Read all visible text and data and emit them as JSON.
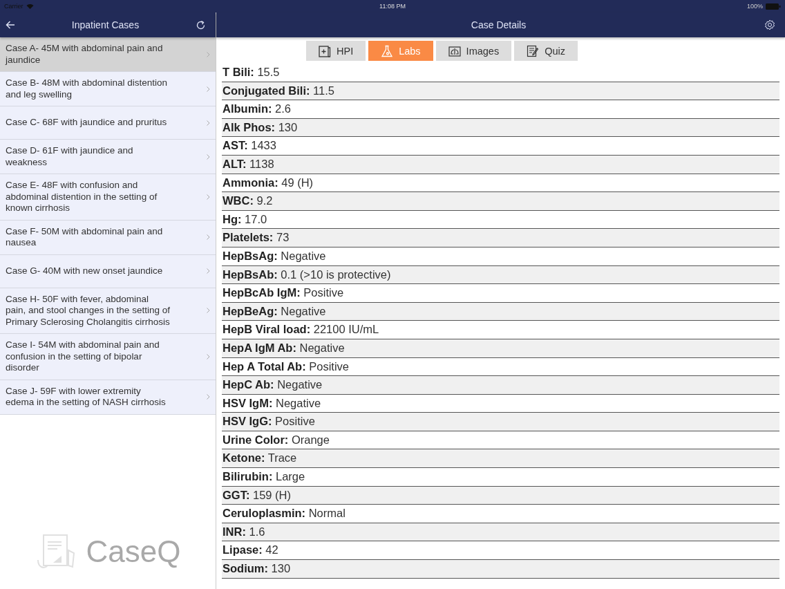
{
  "status_bar": {
    "carrier": "Carrier",
    "time": "11:08 PM",
    "battery": "100%"
  },
  "sidebar": {
    "title": "Inpatient Cases",
    "logo_text": "CaseQ",
    "items": [
      {
        "label": "Case A- 45M with abdominal pain and jaundice",
        "selected": true
      },
      {
        "label": "Case B- 48M with abdominal distention and leg swelling",
        "selected": false
      },
      {
        "label": "Case C- 68F with jaundice and pruritus",
        "selected": false
      },
      {
        "label": "Case D- 61F with jaundice and weakness",
        "selected": false
      },
      {
        "label": "Case E- 48F with confusion and abdominal distention in the setting of known cirrhosis",
        "selected": false
      },
      {
        "label": "Case F- 50M with abdominal pain and nausea",
        "selected": false
      },
      {
        "label": "Case G- 40M with new onset jaundice",
        "selected": false
      },
      {
        "label": "Case H- 50F with fever, abdominal pain, and stool changes in the setting of Primary Sclerosing Cholangitis cirrhosis",
        "selected": false
      },
      {
        "label": "Case I- 54M with abdominal pain and confusion in the setting of bipolar disorder",
        "selected": false
      },
      {
        "label": "Case J- 59F with lower extremity edema in the setting of NASH cirrhosis",
        "selected": false
      }
    ]
  },
  "detail": {
    "title": "Case Details",
    "tabs": [
      {
        "label": "HPI",
        "kind": "hpi",
        "selected": false
      },
      {
        "label": "Labs",
        "kind": "labs",
        "selected": true
      },
      {
        "label": "Images",
        "kind": "images",
        "selected": false
      },
      {
        "label": "Quiz",
        "kind": "quiz",
        "selected": false
      }
    ],
    "labs": [
      {
        "name": "T Bili:",
        "value": "15.5"
      },
      {
        "name": "Conjugated Bili:",
        "value": "11.5"
      },
      {
        "name": "Albumin:",
        "value": "2.6"
      },
      {
        "name": "Alk Phos:",
        "value": "130"
      },
      {
        "name": "AST:",
        "value": "1433"
      },
      {
        "name": "ALT:",
        "value": "1138"
      },
      {
        "name": "Ammonia:",
        "value": "49 (H)"
      },
      {
        "name": "WBC:",
        "value": "9.2"
      },
      {
        "name": "Hg:",
        "value": "17.0"
      },
      {
        "name": "Platelets:",
        "value": "73"
      },
      {
        "name": "HepBsAg:",
        "value": "Negative"
      },
      {
        "name": "HepBsAb:",
        "value": "0.1 (>10 is protective)"
      },
      {
        "name": "HepBcAb IgM:",
        "value": "Positive"
      },
      {
        "name": "HepBeAg:",
        "value": "Negative"
      },
      {
        "name": "HepB Viral load:",
        "value": "22100 IU/mL"
      },
      {
        "name": "HepA IgM Ab:",
        "value": "Negative"
      },
      {
        "name": "Hep A Total Ab:",
        "value": "Positive"
      },
      {
        "name": "HepC Ab:",
        "value": "Negative"
      },
      {
        "name": "HSV IgM:",
        "value": "Negative"
      },
      {
        "name": "HSV IgG:",
        "value": "Positive"
      },
      {
        "name": "Urine Color:",
        "value": "Orange"
      },
      {
        "name": "Ketone:",
        "value": "Trace"
      },
      {
        "name": "Bilirubin:",
        "value": "Large"
      },
      {
        "name": "GGT:",
        "value": "159 (H)"
      },
      {
        "name": "Ceruloplasmin:",
        "value": "Normal"
      },
      {
        "name": "INR:",
        "value": "1.6"
      },
      {
        "name": "Lipase:",
        "value": "42"
      },
      {
        "name": "Sodium:",
        "value": "130"
      }
    ]
  }
}
